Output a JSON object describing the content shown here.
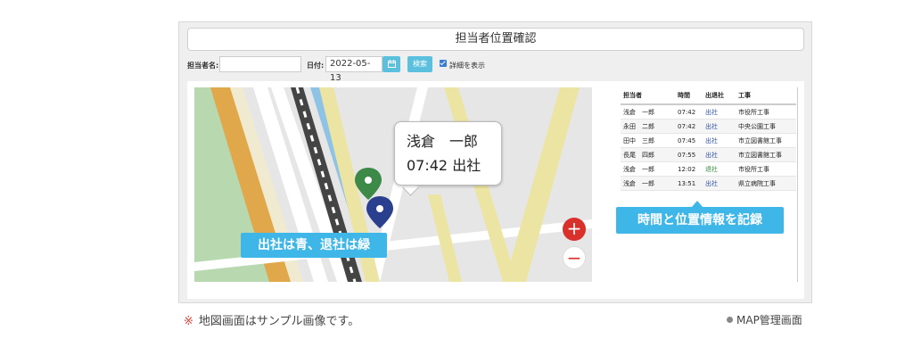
{
  "window": {
    "title": "担当者位置確認"
  },
  "filters": {
    "person_label": "担当者名:",
    "person_value": "",
    "date_label": "日付:",
    "date_value": "2022-05-13",
    "calendar_icon": "calendar-icon",
    "search_label": "検索",
    "details_label": "詳細を表示",
    "details_checked": true
  },
  "map": {
    "popup_name": "浅倉　一郎",
    "popup_time_status": "07:42 出社",
    "legend_callout": "出社は青、退社は緑",
    "zoom_in": "+",
    "zoom_out": "−",
    "pin_colors": {
      "check_in": "#2b3f8f",
      "check_out": "#3d8a48"
    }
  },
  "records": {
    "headers": [
      "担当者",
      "時間",
      "出退社",
      "工事"
    ],
    "rows": [
      {
        "name": "浅倉　一郎",
        "time": "07:42",
        "status": "出社",
        "site": "市役所工事"
      },
      {
        "name": "永田　二郎",
        "time": "07:42",
        "status": "出社",
        "site": "中央公園工事"
      },
      {
        "name": "田中　三郎",
        "time": "07:45",
        "status": "出社",
        "site": "市立図書館工事"
      },
      {
        "name": "長尾　四郎",
        "time": "07:55",
        "status": "出社",
        "site": "市立図書館工事"
      },
      {
        "name": "浅倉　一郎",
        "time": "12:02",
        "status": "退社",
        "site": "市役所工事"
      },
      {
        "name": "浅倉　一郎",
        "time": "13:51",
        "status": "出社",
        "site": "県立病院工事"
      }
    ],
    "callout": "時間と位置情報を記録"
  },
  "note": {
    "mark": "※",
    "text": "地図画面はサンプル画像です。"
  },
  "caption": "MAP管理画面"
}
